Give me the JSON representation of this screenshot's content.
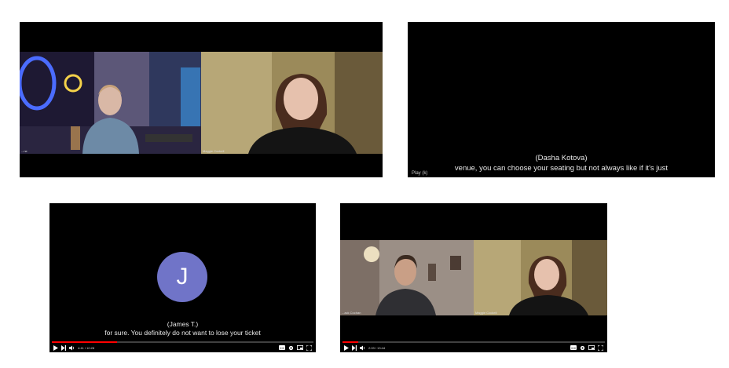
{
  "colors": {
    "page_bg": "#ffffff",
    "video_bg": "#000000",
    "avatar_bg": "#7074c8",
    "progress_played": "#ff0000"
  },
  "panel1": {
    "tile_left": {
      "name_label": "...ne"
    },
    "tile_right": {
      "name_label": "Maggie Cockell"
    }
  },
  "panel2": {
    "caption_speaker": "(Dasha Kotova)",
    "caption_text": "venue, you can choose your seating but not always like if it's just",
    "play_tooltip": "Play (k)"
  },
  "panel3": {
    "avatar_letter": "J",
    "caption_speaker": "(James T.)",
    "caption_text": "for sure. You definitely do not want to lose your ticket",
    "time_display": "4:41 / 10:28",
    "progress_fraction": 0.25
  },
  "panel4": {
    "tile_left": {
      "name_label": "...ack Cochan"
    },
    "tile_right": {
      "name_label": "Maggie Cockell"
    },
    "time_display": "2:03 / 13:44",
    "progress_fraction": 0.06
  },
  "icons": {
    "play": "play-icon",
    "skip": "skip-next-icon",
    "volume": "volume-icon",
    "captions": "subtitles-icon",
    "settings": "gear-icon",
    "miniplayer": "miniplayer-icon",
    "fullscreen": "fullscreen-icon"
  }
}
